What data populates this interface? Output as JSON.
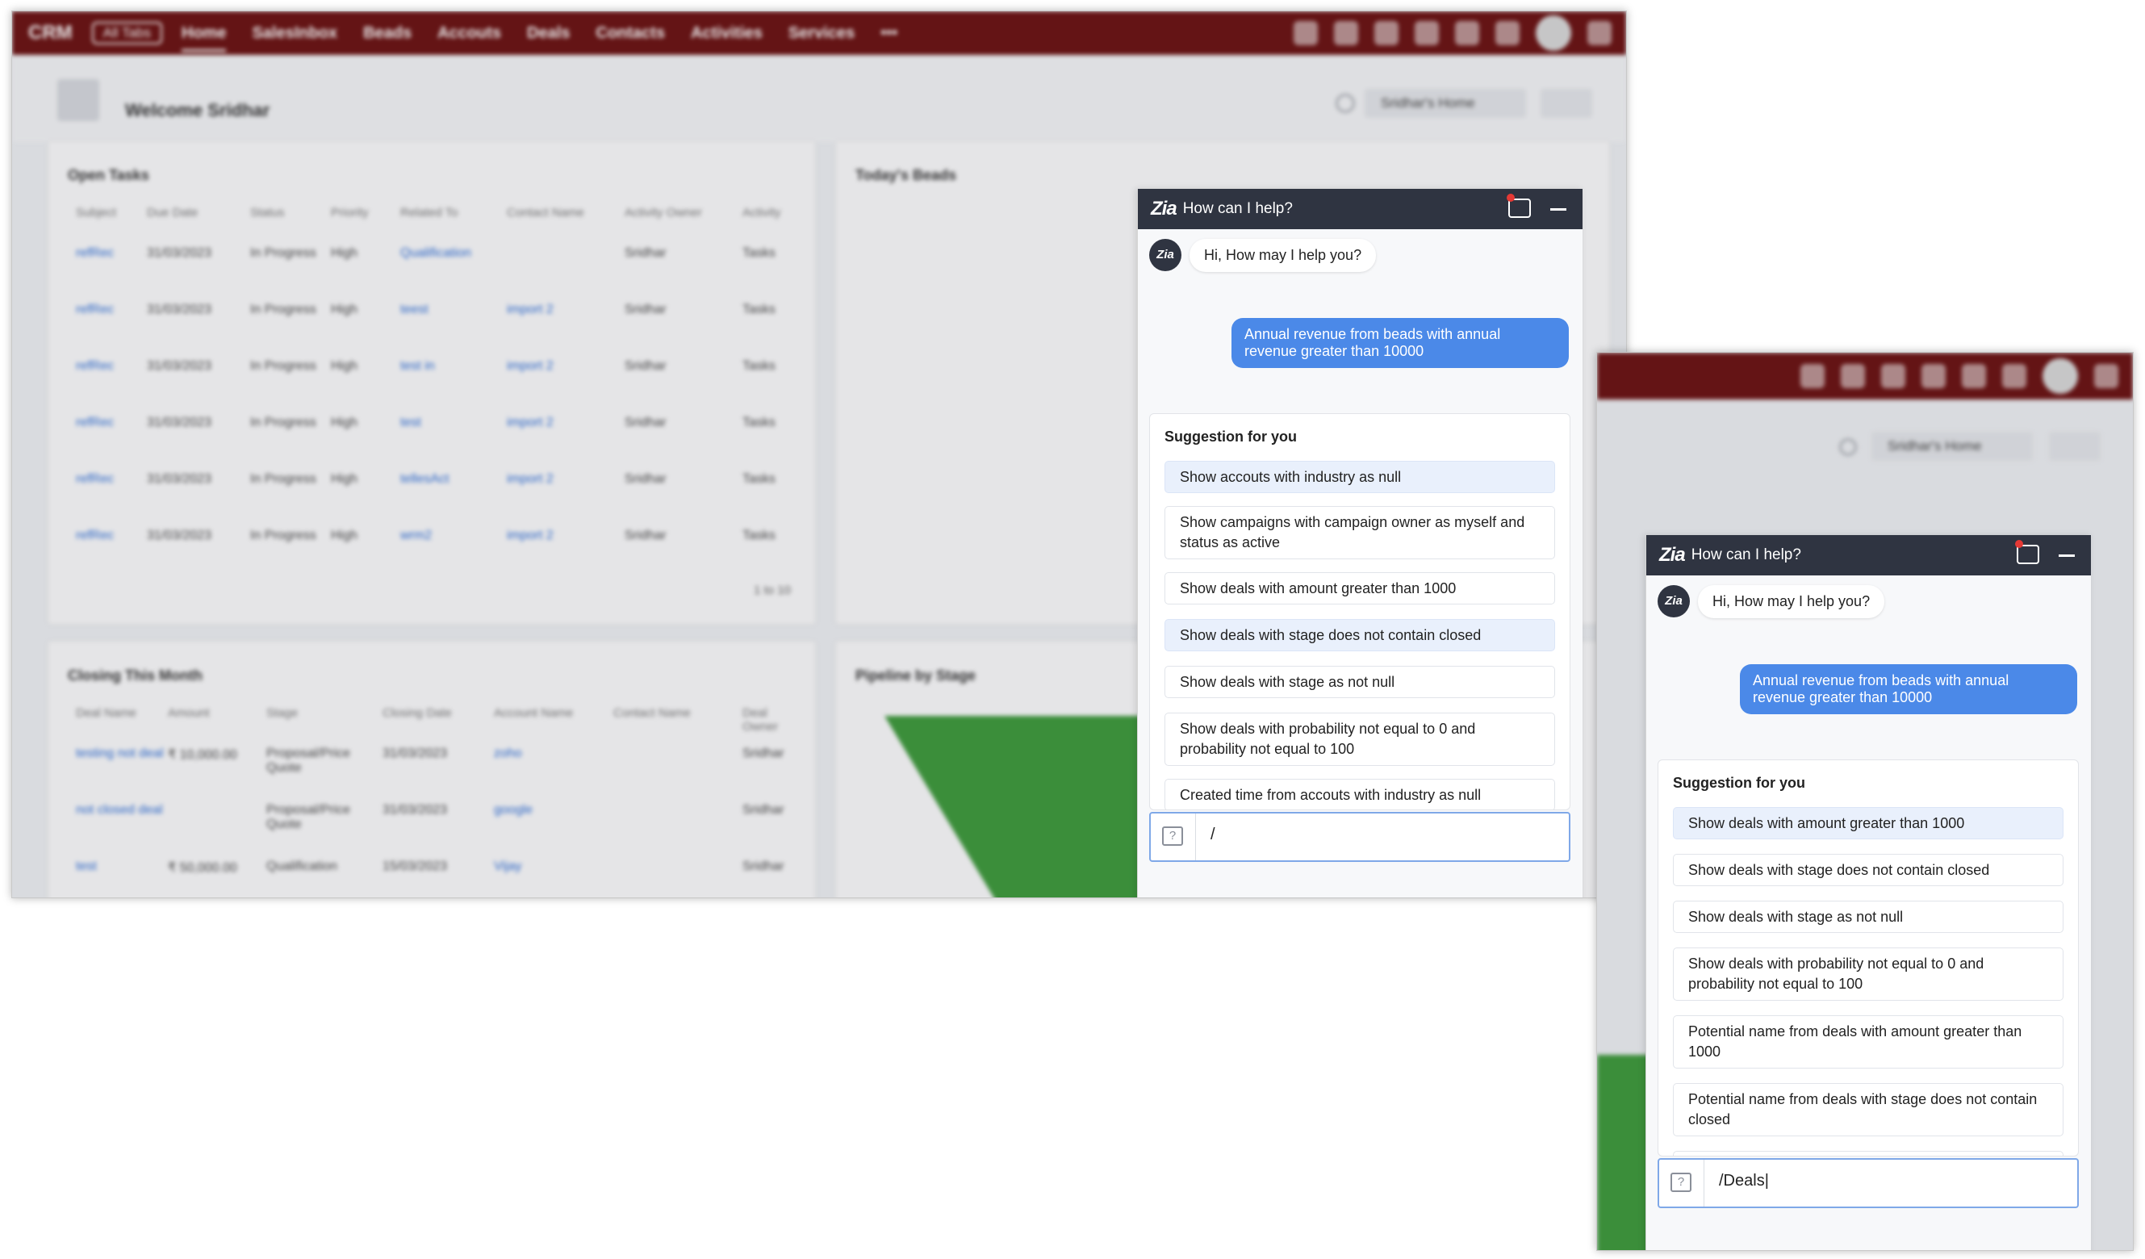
{
  "bg": {
    "app_name": "CRM",
    "view_selector": "All Tabs",
    "nav": [
      "Home",
      "SalesInbox",
      "Beads",
      "Accouts",
      "Deals",
      "Contacts",
      "Activities",
      "Services",
      "•••"
    ],
    "welcome": "Welcome Sridhar",
    "home_selector": "Sridhar's Home",
    "open_tasks": {
      "title": "Open Tasks",
      "columns": [
        "Subject",
        "Due Date",
        "Status",
        "Priority",
        "Related To",
        "Contact Name",
        "Activity Owner",
        "Activity"
      ],
      "rows": [
        {
          "subject": "refRec",
          "due": "31/03/2023",
          "status": "In Progress",
          "priority": "High",
          "related": "Qualification",
          "contact": "",
          "owner": "Sridhar",
          "type": "Tasks"
        },
        {
          "subject": "refRec",
          "due": "31/03/2023",
          "status": "In Progress",
          "priority": "High",
          "related": "teest",
          "contact": "import 2",
          "owner": "Sridhar",
          "type": "Tasks"
        },
        {
          "subject": "refRec",
          "due": "31/03/2023",
          "status": "In Progress",
          "priority": "High",
          "related": "test in",
          "contact": "import 2",
          "owner": "Sridhar",
          "type": "Tasks"
        },
        {
          "subject": "refRec",
          "due": "31/03/2023",
          "status": "In Progress",
          "priority": "High",
          "related": "test",
          "contact": "import 2",
          "owner": "Sridhar",
          "type": "Tasks"
        },
        {
          "subject": "refRec",
          "due": "31/03/2023",
          "status": "In Progress",
          "priority": "High",
          "related": "tellesAct",
          "contact": "import 2",
          "owner": "Sridhar",
          "type": "Tasks"
        },
        {
          "subject": "refRec",
          "due": "31/03/2023",
          "status": "In Progress",
          "priority": "High",
          "related": "wrm2",
          "contact": "import 2",
          "owner": "Sridhar",
          "type": "Tasks"
        }
      ],
      "pager": "1 to 10"
    },
    "todays_beads": {
      "title": "Today's Beads"
    },
    "closing": {
      "title": "Closing This Month",
      "columns": [
        "Deal Name",
        "Amount",
        "Stage",
        "Closing Date",
        "Account Name",
        "Contact Name",
        "Deal Owner"
      ],
      "rows": [
        {
          "deal": "testing not deal",
          "amount": "₹ 10,000.00",
          "stage": "Proposal/Price Quote",
          "date": "31/03/2023",
          "account": "zoho",
          "owner": "Sridhar"
        },
        {
          "deal": "not closed deal",
          "amount": "",
          "stage": "Proposal/Price Quote",
          "date": "31/03/2023",
          "account": "google",
          "owner": "Sridhar"
        },
        {
          "deal": "test",
          "amount": "₹ 50,000.00",
          "stage": "Qualification",
          "date": "15/03/2023",
          "account": "Vijay",
          "owner": "Sridhar"
        }
      ]
    },
    "pipeline": {
      "title": "Pipeline by Stage"
    }
  },
  "chat_common": {
    "zia_mark": "Zia",
    "title": "How can I help?",
    "greeting": "Hi, How may I help you?",
    "user_query": "Annual revenue from beads with annual revenue greater than 10000",
    "suggestion_title": "Suggestion for you"
  },
  "chat_left": {
    "suggestions": [
      "Show accouts with industry as null",
      "Show campaigns with campaign owner as myself and status as active",
      "Show deals with amount greater than 1000",
      "Show deals with stage does not contain closed",
      "Show deals with stage as not null",
      "Show deals with probability not equal to 0 and probability not equal to 100",
      "Created time from accouts with industry as null"
    ],
    "input_value": "/"
  },
  "chat_right": {
    "suggestions": [
      "Show deals with amount greater than 1000",
      "Show deals with stage does not contain closed",
      "Show deals with stage as not null",
      "Show deals with probability not equal to 0 and probability not equal to 100",
      "Potential name from deals with amount greater than 1000",
      "Potential name from deals with stage does not contain closed"
    ],
    "input_value": "/Deals|"
  },
  "colors": {
    "topbar": "#6b1212",
    "chat_header": "#2f3441",
    "user_bubble": "#4b89e8",
    "chip_highlight": "#e9f0fc",
    "input_border": "#7fa8e8"
  }
}
